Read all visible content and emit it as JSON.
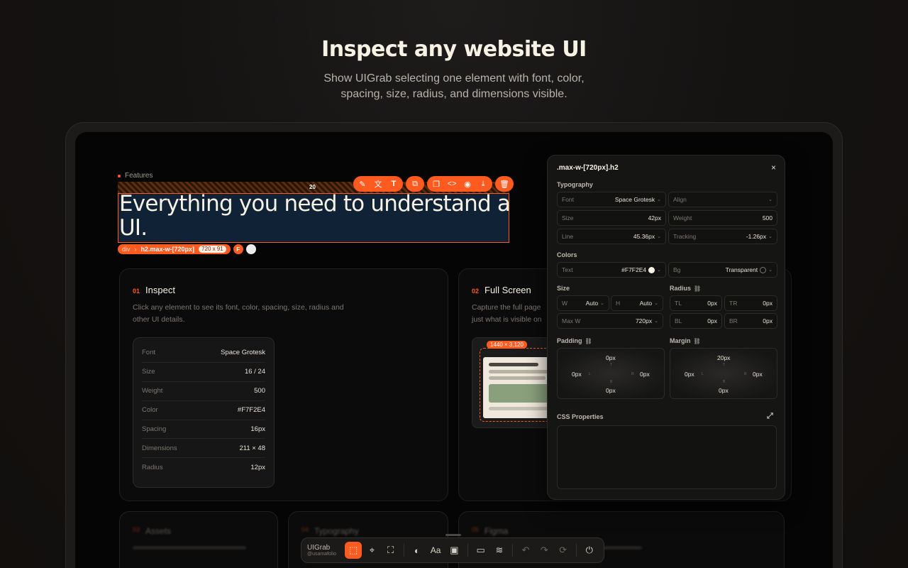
{
  "hero": {
    "title": "Inspect any website UI",
    "subtitle": "Show UIGrab selecting one element with font, color, spacing, size, radius, and dimensions visible."
  },
  "section": {
    "eyebrow": "Features",
    "spacing_value": "20",
    "heading": "Everything you need to understand a UI."
  },
  "selection": {
    "crumb_parent": "div",
    "crumb_arrow": "›",
    "crumb_current": "h2.max-w-[720px]",
    "dimensions": "720 x 91",
    "font_badge": "F"
  },
  "toolbar_icons": [
    "edit-icon",
    "translate-icon",
    "text-icon",
    "copy-style-icon",
    "duplicate-icon",
    "code-icon",
    "camera-icon",
    "download-icon",
    "trash-icon"
  ],
  "cards": {
    "inspect": {
      "num": "01",
      "title": "Inspect",
      "desc": "Click any element to see its font, color, spacing, size, radius and other UI details.",
      "specs": [
        {
          "k": "Font",
          "v": "Space Grotesk"
        },
        {
          "k": "Size",
          "v": "16 / 24"
        },
        {
          "k": "Weight",
          "v": "500"
        },
        {
          "k": "Color",
          "v": "#F7F2E4"
        },
        {
          "k": "Spacing",
          "v": "16px"
        },
        {
          "k": "Dimensions",
          "v": "211 × 48"
        },
        {
          "k": "Radius",
          "v": "12px"
        }
      ]
    },
    "fullscreen": {
      "num": "02",
      "title": "Full Screen",
      "desc": "Capture the full page just what is visible on",
      "badge": "1440 × 3,120"
    },
    "bottom": [
      {
        "num": "03",
        "title": "Assets"
      },
      {
        "num": "04",
        "title": "Typography"
      },
      {
        "num": "05",
        "title": "Figma"
      }
    ]
  },
  "panel": {
    "title": ".max-w-[720px].h2",
    "close": "×",
    "typography": "Typography",
    "font_k": "Font",
    "font_v": "Space Grotesk",
    "align_k": "Align",
    "size_k": "Size",
    "size_v": "42px",
    "weight_k": "Weight",
    "weight_v": "500",
    "line_k": "Line",
    "line_v": "45.36px",
    "tracking_k": "Tracking",
    "tracking_v": "-1.26px",
    "colors": "Colors",
    "text_k": "Text",
    "text_v": "#F7F2E4",
    "bg_k": "Bg",
    "bg_v": "Transparent",
    "size_sec": "Size",
    "radius_sec": "Radius",
    "w_k": "W",
    "w_v": "Auto",
    "h_k": "H",
    "h_v": "Auto",
    "maxw_k": "Max W",
    "maxw_v": "720px",
    "tl_k": "TL",
    "tl_v": "0px",
    "tr_k": "TR",
    "tr_v": "0px",
    "bl_k": "BL",
    "bl_v": "0px",
    "br_k": "BR",
    "br_v": "0px",
    "padding": "Padding",
    "margin": "Margin",
    "pad": {
      "t": "0px",
      "l": "0px",
      "r": "0px",
      "b": "0px"
    },
    "mar": {
      "t": "20px",
      "l": "0px",
      "r": "0px",
      "b": "0px"
    },
    "side_t": "T",
    "side_l": "L",
    "side_r": "R",
    "side_b": "B",
    "css_props": "CSS Properties"
  },
  "dock": {
    "brand": "UIGrab",
    "user": "@usamafolio"
  },
  "colors": {
    "accent": "#ff5a1f",
    "text": "#F7F2E4"
  }
}
